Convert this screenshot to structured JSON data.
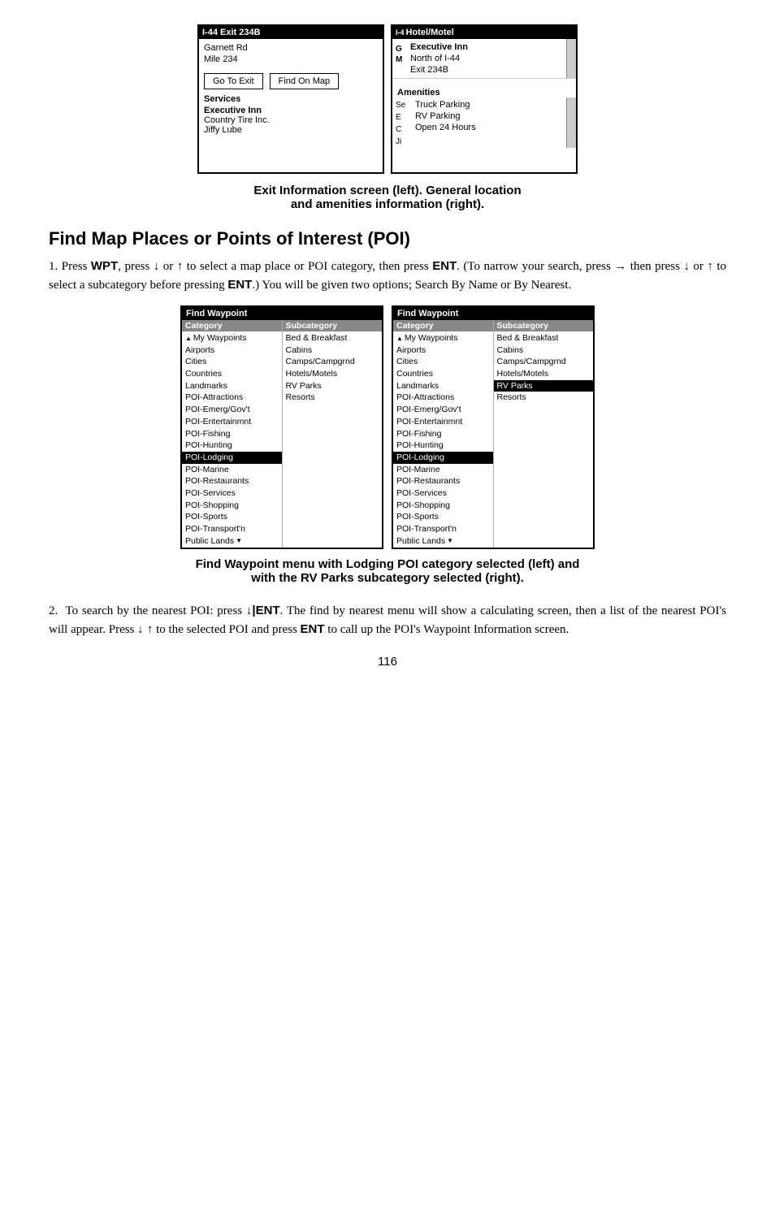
{
  "left_screen": {
    "title": "I-44 Exit 234B",
    "lines": [
      "Garnett Rd",
      "Mile 234"
    ],
    "buttons": [
      "Go To Exit",
      "Find On Map"
    ],
    "services_label": "Services",
    "services_items": [
      {
        "text": "Executive Inn",
        "bold": true
      },
      {
        "text": "Country Tire Inc.",
        "bold": false
      },
      {
        "text": "Jiffy Lube",
        "bold": false
      }
    ]
  },
  "right_screen": {
    "title": "I-4",
    "subtitle": "Hotel/Motel",
    "icons": [
      "G",
      "M"
    ],
    "location_lines": [
      "Executive Inn",
      "North of I-44",
      "Exit 234B"
    ],
    "amenities_label": "Amenities",
    "amenities_icons": [
      "Se",
      "E",
      "C",
      "Ji"
    ],
    "amenities_items": [
      "Truck Parking",
      "RV Parking",
      "Open 24 Hours"
    ]
  },
  "caption_top": {
    "line1": "Exit Information screen (left). General location",
    "line2": "and amenities information (right)."
  },
  "section_heading": "Find Map Places or Points of Interest (POI)",
  "body_text_1": "1. Press WPT, press ↓ or ↑ to select a map place or POI category, then press ENT. (To narrow your search, press → then press ↓ or ↑ to select a subcategory before pressing ENT.) You will be given two options; Search By Name or By Nearest.",
  "wp_left": {
    "title": "Find Waypoint",
    "col1_header": "Category",
    "col2_header": "Subcategory",
    "col1_items": [
      {
        "text": "My Waypoints",
        "scroll": true,
        "highlighted": false
      },
      {
        "text": "Airports",
        "highlighted": false
      },
      {
        "text": "Cities",
        "highlighted": false
      },
      {
        "text": "Countries",
        "highlighted": false
      },
      {
        "text": "Landmarks",
        "highlighted": false
      },
      {
        "text": "POI-Attractions",
        "highlighted": false
      },
      {
        "text": "POI-Emerg/Gov't",
        "highlighted": false
      },
      {
        "text": "POI-Entertainmnt",
        "highlighted": false
      },
      {
        "text": "POI-Fishing",
        "highlighted": false
      },
      {
        "text": "POI-Hunting",
        "highlighted": false
      },
      {
        "text": "POI-Lodging",
        "highlighted": true
      },
      {
        "text": "POI-Marine",
        "highlighted": false
      },
      {
        "text": "POI-Restaurants",
        "highlighted": false
      },
      {
        "text": "POI-Services",
        "highlighted": false
      },
      {
        "text": "POI-Shopping",
        "highlighted": false
      },
      {
        "text": "POI-Sports",
        "highlighted": false
      },
      {
        "text": "POI-Transport'n",
        "highlighted": false
      },
      {
        "text": "Public Lands",
        "highlighted": false,
        "scroll_down": true
      }
    ],
    "col2_items": [
      {
        "text": "Bed & Breakfast",
        "highlighted": false
      },
      {
        "text": "Cabins",
        "highlighted": false
      },
      {
        "text": "Camps/Campgrnd",
        "highlighted": false
      },
      {
        "text": "Hotels/Motels",
        "highlighted": false
      },
      {
        "text": "RV Parks",
        "highlighted": false
      },
      {
        "text": "Resorts",
        "highlighted": false
      }
    ]
  },
  "wp_right": {
    "title": "Find Waypoint",
    "col1_header": "Category",
    "col2_header": "Subcategory",
    "col1_items": [
      {
        "text": "My Waypoints",
        "scroll": true,
        "highlighted": false
      },
      {
        "text": "Airports",
        "highlighted": false
      },
      {
        "text": "Cities",
        "highlighted": false
      },
      {
        "text": "Countries",
        "highlighted": false
      },
      {
        "text": "Landmarks",
        "highlighted": false
      },
      {
        "text": "POI-Attractions",
        "highlighted": false
      },
      {
        "text": "POI-Emerg/Gov't",
        "highlighted": false
      },
      {
        "text": "POI-Entertainmnt",
        "highlighted": false
      },
      {
        "text": "POI-Fishing",
        "highlighted": false
      },
      {
        "text": "POI-Hunting",
        "highlighted": false
      },
      {
        "text": "POI-Lodging",
        "highlighted": true
      },
      {
        "text": "POI-Marine",
        "highlighted": false
      },
      {
        "text": "POI-Restaurants",
        "highlighted": false
      },
      {
        "text": "POI-Services",
        "highlighted": false
      },
      {
        "text": "POI-Shopping",
        "highlighted": false
      },
      {
        "text": "POI-Sports",
        "highlighted": false
      },
      {
        "text": "POI-Transport'n",
        "highlighted": false
      },
      {
        "text": "Public Lands",
        "highlighted": false,
        "scroll_down": true
      }
    ],
    "col2_items": [
      {
        "text": "Bed & Breakfast",
        "highlighted": false
      },
      {
        "text": "Cabins",
        "highlighted": false
      },
      {
        "text": "Camps/Campgrnd",
        "highlighted": false
      },
      {
        "text": "Hotels/Motels",
        "highlighted": false
      },
      {
        "text": "RV Parks",
        "highlighted": true
      },
      {
        "text": "Resorts",
        "highlighted": false
      }
    ]
  },
  "caption_bottom": {
    "line1": "Find Waypoint menu with Lodging POI category selected (left) and",
    "line2": "with the RV Parks subcategory selected (right)."
  },
  "body_text_2_parts": [
    "2.  To search by the nearest POI: press ",
    "↓|ENT",
    ". The find by nearest menu will show a calculating screen, then a list of the nearest POI's will appear. Press ",
    "↓ ↑",
    " to the selected POI and press ",
    "ENT",
    " to call up the POI's Waypoint Information screen."
  ],
  "page_number": "116"
}
